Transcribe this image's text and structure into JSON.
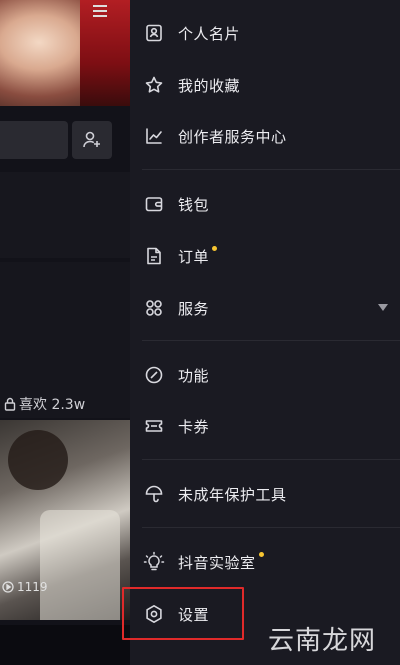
{
  "background": {
    "likes_text": "喜欢 2.3w",
    "plays_text": "1119"
  },
  "menu": {
    "profile_card": "个人名片",
    "favorites": "我的收藏",
    "creator_center": "创作者服务中心",
    "wallet": "钱包",
    "orders": "订单",
    "services": "服务",
    "features": "功能",
    "coupons": "卡券",
    "minor_protection": "未成年保护工具",
    "lab": "抖音实验室",
    "settings": "设置"
  },
  "watermark": "云南龙网",
  "colors": {
    "badge_dot": "#f7c531",
    "highlight": "#e02a2a",
    "drawer_bg": "#1a1a22"
  }
}
